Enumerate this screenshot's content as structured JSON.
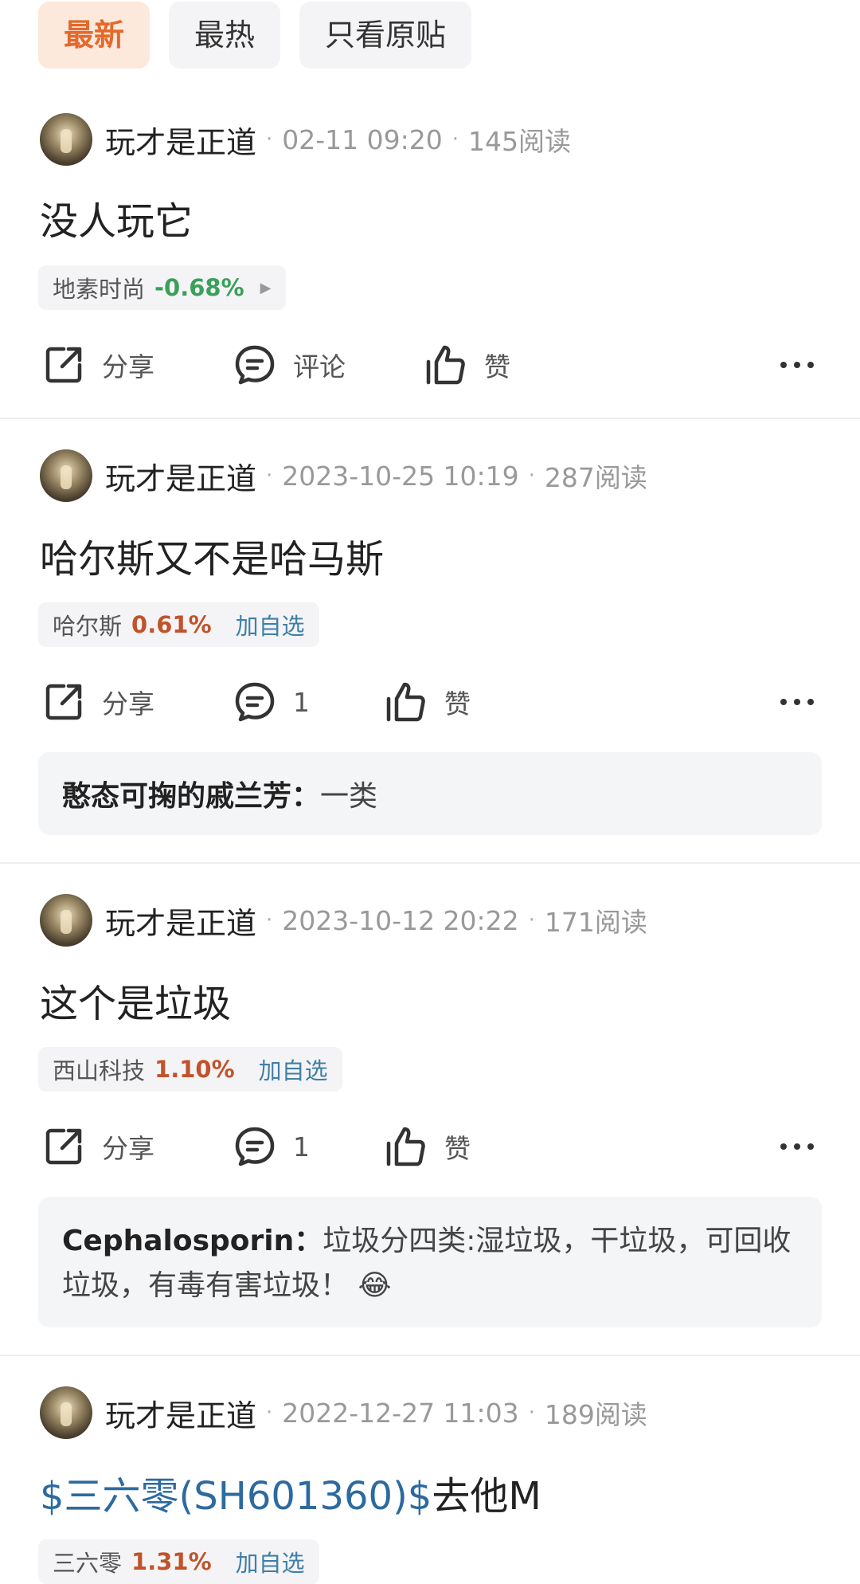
{
  "tabs": [
    {
      "label": "最新",
      "active": true
    },
    {
      "label": "最热",
      "active": false
    },
    {
      "label": "只看原贴",
      "active": false
    }
  ],
  "colors": {
    "up": "#c0532a",
    "down": "#3aa05a",
    "link": "#2c6aa0",
    "accent": "#e26a2c"
  },
  "actions": {
    "share_label": "分享",
    "comment_label": "评论",
    "like_label": "赞"
  },
  "posts": [
    {
      "author": "玩才是正道",
      "date": "02-11 09:20",
      "reads": "145阅读",
      "text": "没人玩它",
      "stock": {
        "name": "地素时尚",
        "change": "-0.68%",
        "direction": "down",
        "add_label": ""
      },
      "comment_count": ""
    },
    {
      "author": "玩才是正道",
      "date": "2023-10-25 10:19",
      "reads": "287阅读",
      "text": "哈尔斯又不是哈马斯",
      "stock": {
        "name": "哈尔斯",
        "change": "0.61%",
        "direction": "up",
        "add_label": "加自选"
      },
      "comment_count": "1",
      "reply": {
        "user": "憨态可掬的戚兰芳",
        "sep": "：",
        "text": "一类"
      }
    },
    {
      "author": "玩才是正道",
      "date": "2023-10-12 20:22",
      "reads": "171阅读",
      "text": "这个是垃圾",
      "stock": {
        "name": "西山科技",
        "change": "1.10%",
        "direction": "up",
        "add_label": "加自选"
      },
      "comment_count": "1",
      "reply": {
        "user": "Cephalosporin",
        "sep": "：",
        "text": "垃圾分四类:湿垃圾，干垃圾，可回收垃圾，有毒有害垃圾！",
        "emoji": "😂"
      }
    },
    {
      "author": "玩才是正道",
      "date": "2022-12-27 11:03",
      "reads": "189阅读",
      "text_link": "$三六零(SH601360)$",
      "text": "去他M",
      "stock": {
        "name": "三六零",
        "change": "1.31%",
        "direction": "up",
        "add_label": "加自选"
      }
    }
  ]
}
